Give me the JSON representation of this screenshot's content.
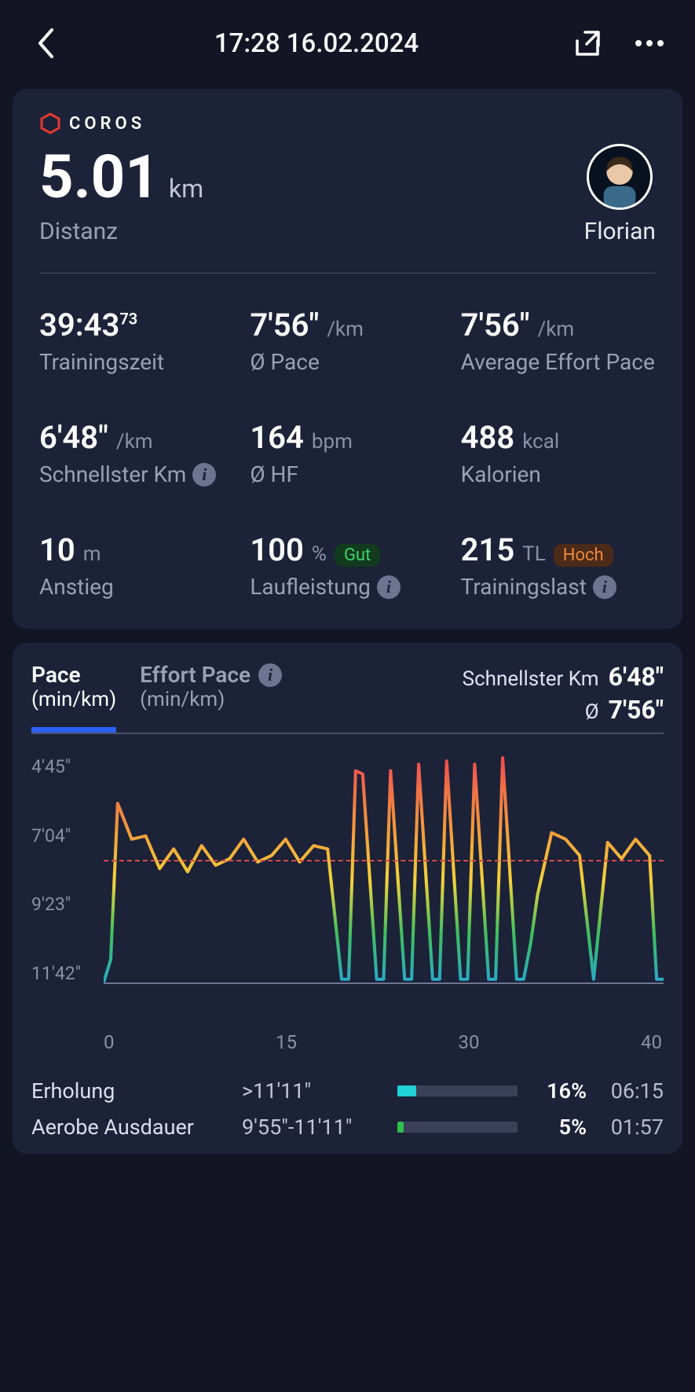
{
  "header": {
    "title": "17:28 16.02.2024"
  },
  "summary": {
    "brand": "COROS",
    "distance_value": "5.01",
    "distance_unit": "km",
    "distance_label": "Distanz",
    "user_name": "Florian",
    "metrics": [
      {
        "value": "39:43",
        "sup": "73",
        "unit": "",
        "label": "Trainingszeit"
      },
      {
        "value": "7'56\"",
        "unit": "/km",
        "label": "Ø Pace"
      },
      {
        "value": "7'56\"",
        "unit": "/km",
        "label": "Average Effort Pace"
      },
      {
        "value": "6'48\"",
        "unit": "/km",
        "label": "Schnellster Km",
        "info": true
      },
      {
        "value": "164",
        "unit": "bpm",
        "label": "Ø HF"
      },
      {
        "value": "488",
        "unit": "kcal",
        "label": "Kalorien"
      },
      {
        "value": "10",
        "unit": "m",
        "label": "Anstieg"
      },
      {
        "value": "100",
        "unit": "%",
        "label": "Laufleistung",
        "badge": "Gut",
        "badge_color": "green",
        "info": true
      },
      {
        "value": "215",
        "unit": "TL",
        "label": "Trainingslast",
        "badge": "Hoch",
        "badge_color": "orange",
        "info": true
      }
    ]
  },
  "chart": {
    "tabs": [
      {
        "l1": "Pace",
        "l2": "(min/km)",
        "active": true
      },
      {
        "l1": "Effort Pace",
        "l2": "(min/km)",
        "info": true
      }
    ],
    "right": [
      {
        "label": "Schnellster Km",
        "value": "6'48\""
      },
      {
        "label": "Ø",
        "value": "7'56\""
      }
    ],
    "ylabels": [
      "4'45\"",
      "7'04\"",
      "9'23\"",
      "11'42\""
    ],
    "xlabels": [
      "0",
      "15",
      "30",
      "40"
    ]
  },
  "zones": [
    {
      "name": "Erholung",
      "range": ">11'11\"",
      "pct": 16,
      "pct_label": "16%",
      "time": "06:15",
      "color": "#1fd0d6"
    },
    {
      "name": "Aerobe Ausdauer",
      "range": "9'55\"-11'11\"",
      "pct": 5,
      "pct_label": "5%",
      "time": "01:57",
      "color": "#2fbe4e"
    }
  ],
  "chart_data": {
    "type": "line",
    "title": "Pace (min/km)",
    "xlabel": "min",
    "ylabel": "Pace (min/km)",
    "ylim": [
      11.7,
      4.75
    ],
    "xlim": [
      0,
      40
    ],
    "average": 7.93,
    "x": [
      0,
      0.5,
      1,
      2,
      3,
      4,
      5,
      6,
      7,
      8,
      9,
      10,
      11,
      12,
      13,
      14,
      15,
      16,
      17,
      17.5,
      18,
      18.5,
      19.5,
      20,
      20.5,
      21.5,
      22,
      22.5,
      23.5,
      24,
      24.5,
      25.5,
      26,
      26.5,
      27.5,
      28,
      28.5,
      29.5,
      30,
      30.5,
      31,
      32,
      33,
      34,
      35,
      36,
      37,
      38,
      39,
      39.5,
      40
    ],
    "values": [
      11.7,
      11.0,
      6.2,
      7.3,
      7.2,
      8.2,
      7.6,
      8.3,
      7.5,
      8.1,
      7.9,
      7.3,
      8.0,
      7.8,
      7.3,
      8.0,
      7.5,
      7.6,
      11.6,
      11.6,
      5.2,
      5.3,
      11.6,
      11.6,
      5.2,
      11.6,
      11.6,
      5.0,
      11.6,
      11.6,
      4.9,
      11.6,
      11.6,
      5.0,
      11.6,
      11.6,
      4.8,
      11.6,
      11.6,
      10.5,
      9.0,
      7.1,
      7.3,
      7.8,
      11.6,
      7.4,
      7.9,
      7.3,
      7.8,
      11.6,
      11.6
    ]
  }
}
